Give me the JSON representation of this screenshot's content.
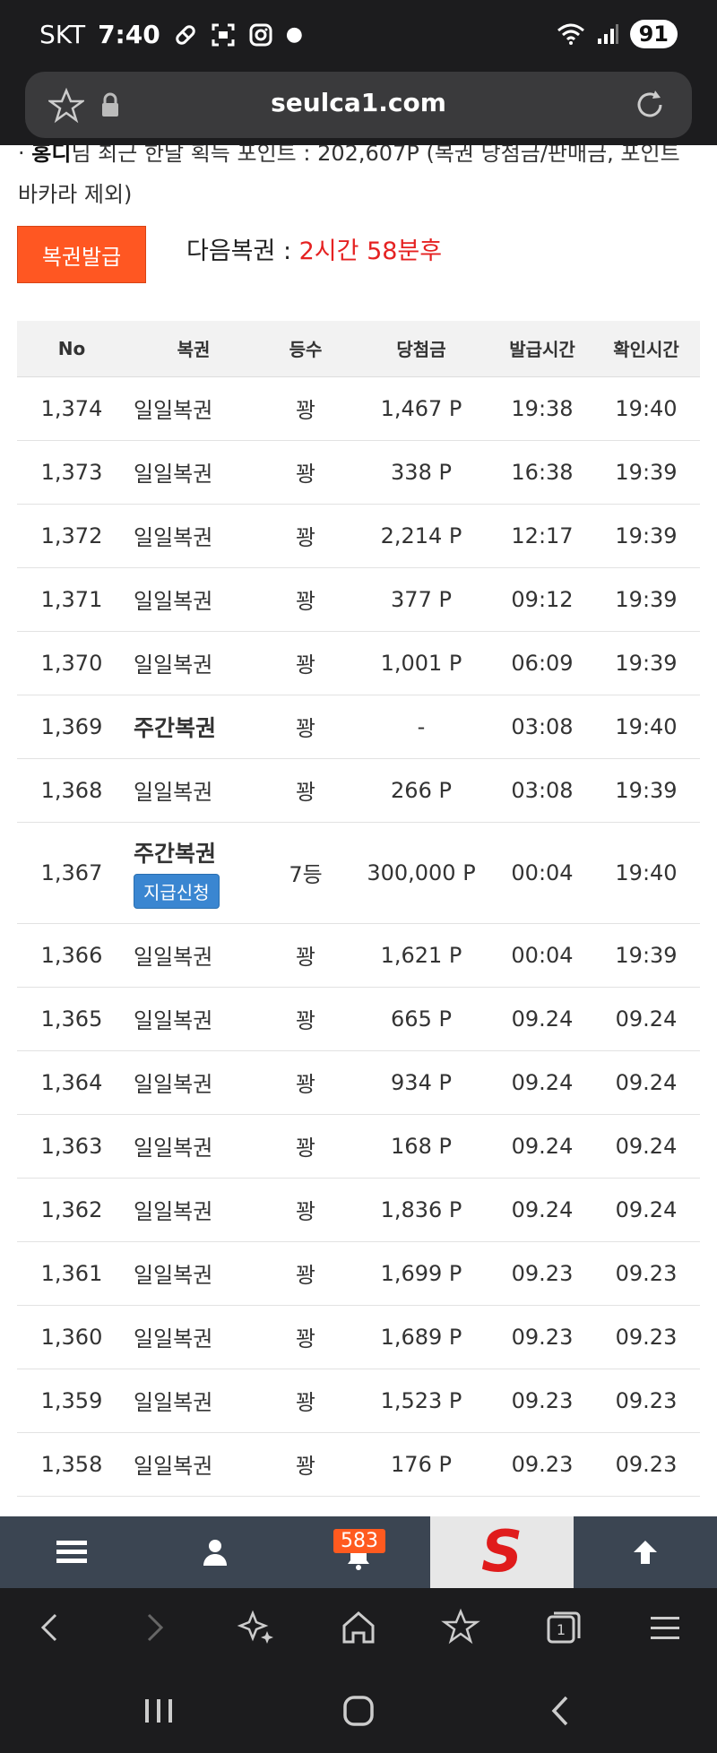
{
  "status_bar": {
    "carrier": "SKT",
    "time": "7:40",
    "battery": "91"
  },
  "browser": {
    "url": "seulca1.com"
  },
  "notice": {
    "user": "홍디",
    "text": "님 최근 한달 획득 포인트 : 202,607P (복권 당첨금/판매금, 포인트 바카라 제외)"
  },
  "issue": {
    "button_label": "복권발급",
    "next_label": "다음복권 : ",
    "next_remaining": "2시간 58분후"
  },
  "table": {
    "headers": [
      "No",
      "복권",
      "등수",
      "당첨금",
      "발급시간",
      "확인시간"
    ],
    "claim_label": "지급신청",
    "rows": [
      {
        "no": "1,374",
        "type": "일일복권",
        "rank": "꽝",
        "prize": "1,467 P",
        "issued": "19:38",
        "checked": "19:40"
      },
      {
        "no": "1,373",
        "type": "일일복권",
        "rank": "꽝",
        "prize": "338 P",
        "issued": "16:38",
        "checked": "19:39"
      },
      {
        "no": "1,372",
        "type": "일일복권",
        "rank": "꽝",
        "prize": "2,214 P",
        "issued": "12:17",
        "checked": "19:39"
      },
      {
        "no": "1,371",
        "type": "일일복권",
        "rank": "꽝",
        "prize": "377 P",
        "issued": "09:12",
        "checked": "19:39"
      },
      {
        "no": "1,370",
        "type": "일일복권",
        "rank": "꽝",
        "prize": "1,001 P",
        "issued": "06:09",
        "checked": "19:39"
      },
      {
        "no": "1,369",
        "type": "주간복권",
        "rank": "꽝",
        "prize": "-",
        "issued": "03:08",
        "checked": "19:40"
      },
      {
        "no": "1,368",
        "type": "일일복권",
        "rank": "꽝",
        "prize": "266 P",
        "issued": "03:08",
        "checked": "19:39"
      },
      {
        "no": "1,367",
        "type": "주간복권",
        "rank": "7등",
        "prize": "300,000 P",
        "issued": "00:04",
        "checked": "19:40"
      },
      {
        "no": "1,366",
        "type": "일일복권",
        "rank": "꽝",
        "prize": "1,621 P",
        "issued": "00:04",
        "checked": "19:39"
      },
      {
        "no": "1,365",
        "type": "일일복권",
        "rank": "꽝",
        "prize": "665 P",
        "issued": "09.24",
        "checked": "09.24"
      },
      {
        "no": "1,364",
        "type": "일일복권",
        "rank": "꽝",
        "prize": "934 P",
        "issued": "09.24",
        "checked": "09.24"
      },
      {
        "no": "1,363",
        "type": "일일복권",
        "rank": "꽝",
        "prize": "168 P",
        "issued": "09.24",
        "checked": "09.24"
      },
      {
        "no": "1,362",
        "type": "일일복권",
        "rank": "꽝",
        "prize": "1,836 P",
        "issued": "09.24",
        "checked": "09.24"
      },
      {
        "no": "1,361",
        "type": "일일복권",
        "rank": "꽝",
        "prize": "1,699 P",
        "issued": "09.23",
        "checked": "09.23"
      },
      {
        "no": "1,360",
        "type": "일일복권",
        "rank": "꽝",
        "prize": "1,689 P",
        "issued": "09.23",
        "checked": "09.23"
      },
      {
        "no": "1,359",
        "type": "일일복권",
        "rank": "꽝",
        "prize": "1,523 P",
        "issued": "09.23",
        "checked": "09.23"
      },
      {
        "no": "1,358",
        "type": "일일복권",
        "rank": "꽝",
        "prize": "176 P",
        "issued": "09.23",
        "checked": "09.23"
      }
    ]
  },
  "site_nav": {
    "notification_count": "583",
    "logo_letter": "S"
  },
  "colors": {
    "accent_orange": "#ff5722",
    "remain_red": "#e52222",
    "claim_blue": "#3a86d1",
    "nav_bg": "#3b4552"
  },
  "icons": {
    "status": [
      "pill-icon",
      "screen-capture-icon",
      "instagram-icon",
      "dot-icon",
      "wifi-icon",
      "signal-icon"
    ],
    "url_bar": [
      "star-icon",
      "lock-icon",
      "reload-icon"
    ],
    "site_nav": [
      "menu-icon",
      "user-icon",
      "bell-icon",
      "arrow-up-icon"
    ],
    "browser_bar": [
      "back-icon",
      "forward-icon",
      "sparkle-icon",
      "home-icon",
      "bookmark-icon",
      "tabs-icon",
      "menu-icon"
    ],
    "android_nav": [
      "recents-icon",
      "home-button-icon",
      "back-icon"
    ]
  }
}
